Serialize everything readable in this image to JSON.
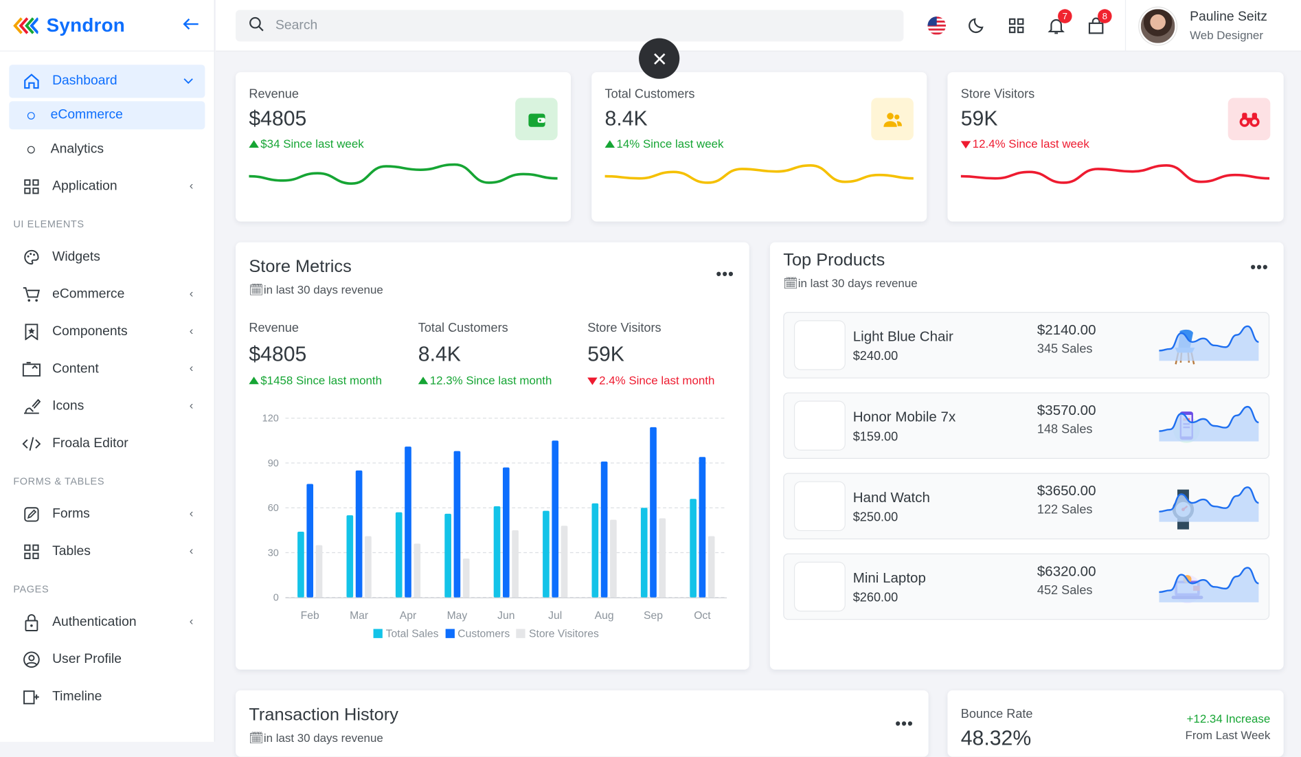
{
  "app": {
    "name": "Syndron"
  },
  "colors": {
    "primary": "#0d6efd",
    "green": "#16a534",
    "yellow": "#f5c000",
    "red": "#ee1b30",
    "cyan": "#13c3e8"
  },
  "sidebar": {
    "dashboard": "Dashboard",
    "sub": [
      "eCommerce",
      "Analytics"
    ],
    "application": "Application",
    "ui_head": "UI ELEMENTS",
    "ui": [
      "Widgets",
      "eCommerce",
      "Components",
      "Content",
      "Icons",
      "Froala Editor"
    ],
    "forms_head": "FORMS & TABLES",
    "forms": [
      "Forms",
      "Tables"
    ],
    "pages_head": "PAGES",
    "pages": [
      "Authentication",
      "User Profile",
      "Timeline"
    ]
  },
  "topbar": {
    "search_placeholder": "Search",
    "bell_count": "7",
    "cart_count": "8",
    "user_name": "Pauline Seitz",
    "user_role": "Web Designer"
  },
  "stats": [
    {
      "label": "Revenue",
      "value": "$4805",
      "change": "$34 Since last week",
      "dir": "up",
      "color": "#16a534",
      "spark": [
        0.45,
        0.55,
        0.38,
        0.62,
        0.22,
        0.3,
        0.18,
        0.6,
        0.4,
        0.5
      ]
    },
    {
      "label": "Total Customers",
      "value": "8.4K",
      "change": "14% Since last week",
      "dir": "up",
      "color": "#f5c000",
      "spark": [
        0.45,
        0.5,
        0.35,
        0.6,
        0.28,
        0.34,
        0.2,
        0.58,
        0.42,
        0.5
      ]
    },
    {
      "label": "Store Visitors",
      "value": "59K",
      "change": "12.4% Since last week",
      "dir": "down",
      "color": "#ee1b30",
      "spark": [
        0.45,
        0.5,
        0.35,
        0.6,
        0.28,
        0.34,
        0.2,
        0.58,
        0.42,
        0.5
      ]
    }
  ],
  "store_metrics": {
    "title": "Store Metrics",
    "subtitle": "in last 30 days revenue",
    "metrics": [
      {
        "label": "Revenue",
        "value": "$4805",
        "change": "$1458 Since last month",
        "dir": "up"
      },
      {
        "label": "Total Customers",
        "value": "8.4K",
        "change": "12.3% Since last month",
        "dir": "up"
      },
      {
        "label": "Store Visitors",
        "value": "59K",
        "change": "2.4% Since last month",
        "dir": "down"
      }
    ]
  },
  "chart_data": {
    "type": "bar",
    "categories": [
      "Feb",
      "Mar",
      "Apr",
      "May",
      "Jun",
      "Jul",
      "Aug",
      "Sep",
      "Oct"
    ],
    "series": [
      {
        "name": "Total Sales",
        "color": "#13c3e8",
        "values": [
          44,
          55,
          57,
          56,
          61,
          58,
          63,
          60,
          66
        ]
      },
      {
        "name": "Customers",
        "color": "#0d6efd",
        "values": [
          76,
          85,
          101,
          98,
          87,
          105,
          91,
          114,
          94
        ]
      },
      {
        "name": "Store Visitores",
        "color": "#e5e6e8",
        "values": [
          35,
          41,
          36,
          26,
          45,
          48,
          52,
          53,
          41
        ]
      }
    ],
    "ylim": [
      0,
      120
    ],
    "yticks": [
      0,
      30,
      60,
      90,
      120
    ],
    "grid": true,
    "legend": "bottom"
  },
  "top_products": {
    "title": "Top Products",
    "subtitle": "in last 30 days revenue",
    "items": [
      {
        "name": "Light Blue Chair",
        "price": "$240.00",
        "revenue": "$2140.00",
        "sales": "345 Sales",
        "icon": "chair-icon"
      },
      {
        "name": "Honor Mobile 7x",
        "price": "$159.00",
        "revenue": "$3570.00",
        "sales": "148 Sales",
        "icon": "mobile-icon"
      },
      {
        "name": "Hand Watch",
        "price": "$250.00",
        "revenue": "$3650.00",
        "sales": "122 Sales",
        "icon": "watch-icon"
      },
      {
        "name": "Mini Laptop",
        "price": "$260.00",
        "revenue": "$6320.00",
        "sales": "452 Sales",
        "icon": "laptop-icon"
      }
    ]
  },
  "transactions": {
    "title": "Transaction History",
    "subtitle": "in last 30 days revenue"
  },
  "bounce": {
    "label": "Bounce Rate",
    "value": "48.32%",
    "change": "+12.34 Increase",
    "sub": "From Last Week"
  }
}
